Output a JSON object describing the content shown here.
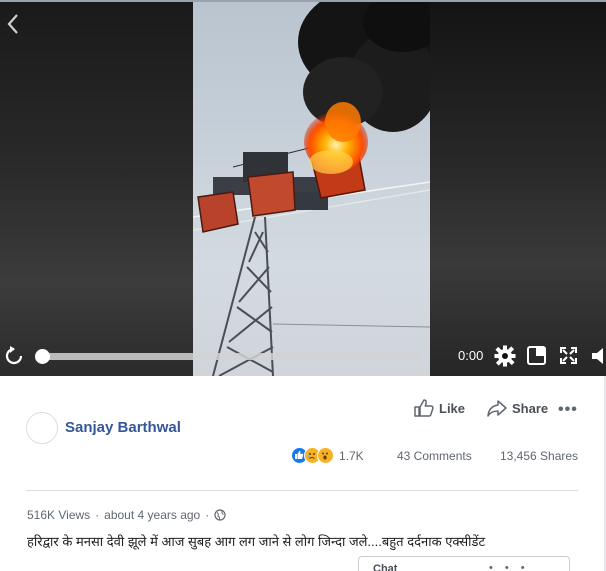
{
  "video": {
    "time": "0:00",
    "progress": 0,
    "icons": {
      "back": "chevron-left-icon",
      "replay": "replay-icon",
      "settings": "gear-icon",
      "pip": "picture-in-picture-icon",
      "fullscreen": "fullscreen-icon",
      "volume": "volume-icon"
    }
  },
  "post": {
    "author": "Sanjay Barthwal",
    "like_label": "Like",
    "share_label": "Share",
    "more_label": "•••",
    "reactions": [
      "like",
      "sad",
      "wow"
    ],
    "reaction_count": "1.7K",
    "comments": "43 Comments",
    "shares": "13,456 Shares",
    "views": "516K Views",
    "time_ago": "about 4 years ago",
    "caption": "हरिद्वार के मनसा देवी झूले में आज सुबह आग लग जाने से लोग जिन्दा जले....बहुत दर्दनाक एक्सीडेंट"
  },
  "chat": {
    "label": "Chat"
  },
  "colors": {
    "author": "#365899",
    "like_reaction": "#1877f2",
    "sad_reaction": "#f7b125",
    "fire": "#ff6a00"
  }
}
